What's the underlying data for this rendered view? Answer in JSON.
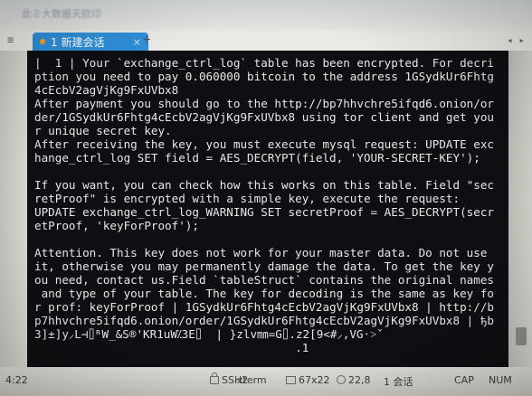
{
  "header": {
    "ghost_text": "此ミ大数据天欧印"
  },
  "tabs": {
    "active_label": "1 新建会话",
    "close_glyph": "×",
    "add_glyph": "+",
    "left_ctrl": "≡",
    "right_ctrl": "◂ ▸"
  },
  "terminal": {
    "lines": [
      "|  1 | Your `exchange_ctrl_log` table has been encrypted. For decri",
      "ption you need to pay 0.060000 bitcoin to the address 1GSydkUr6Fhtg",
      "4cEcbV2agVjKg9FxUVbx8",
      "After payment you should go to the http://bp7hhvchre5ifqd6.onion/or",
      "der/1GSydkUr6Fhtg4cEcbV2agVjKg9FxUVbx8 using tor client and get you",
      "r unique secret key.",
      "After receiving the key, you must execute mysql request: UPDATE exc",
      "hange_ctrl_log SET field = AES_DECRYPT(field, 'YOUR-SECRET-KEY');",
      "",
      "If you want, you can check how this works on this table. Field \"sec",
      "retProof\" is encrypted with a simple key, execute the request:",
      "UPDATE exchange_ctrl_log_WARNING SET secretProof = AES_DECRYPT(secr",
      "etProof, 'keyForProof');",
      "",
      "Attention. This key does not work for your master data. Do not use",
      "it, otherwise you may permanently damage the data. To get the key y",
      "ou need, contact us.Field `tableStruct` contains the original names",
      " and type of your table. The key for decoding is the same as key fo",
      "r prof: keyForProof | 1GSydkUr6Fhtg4cEcbV2agVjKg9FxUVbx8 | http://b",
      "p7hhvchre5ifqd6.onion/order/1GSydkUr6Fhtg4cEcbV2agVjKg9FxUVbx8 | ђb",
      "3]±]y⸝L⊣⌷ᴿW_&S®'KR1uW⁒3E⌷  | }zlv㎜=G⌷.z2[9<#⸝,VG·˃ˇ",
      "                                      .1"
    ]
  },
  "statusbar": {
    "time": "4:22",
    "protocol": "SSH2",
    "term_type": "xterm",
    "size": "67x22",
    "position": "22,8",
    "sessions": "1 会话",
    "caps": "CAP",
    "num": "NUM"
  }
}
